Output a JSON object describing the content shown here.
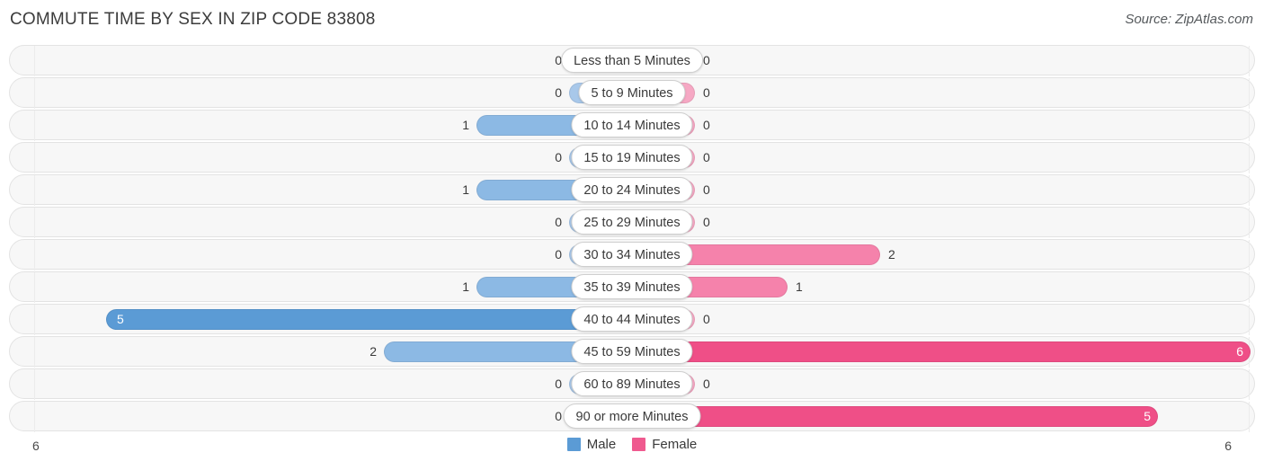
{
  "header": {
    "title": "COMMUTE TIME BY SEX IN ZIP CODE 83808",
    "source": "Source: ZipAtlas.com"
  },
  "legend": {
    "items": [
      {
        "label": "Male",
        "color": "#5b9bd5"
      },
      {
        "label": "Female",
        "color": "#ef5a8f"
      }
    ]
  },
  "axis": {
    "left_label": "6",
    "right_label": "6"
  },
  "colors": {
    "male_strong": "#5b9bd5",
    "male_mid": "#8cb9e4",
    "male_pale": "#a8c8ea",
    "female_strong": "#ef4f87",
    "female_mid": "#f582ab",
    "female_pale": "#f6a8c4",
    "track_fill": "#f7f7f7",
    "track_border": "#e3e3e3"
  },
  "chart_data": {
    "type": "bar",
    "subtype": "diverging-bidirectional",
    "title": "COMMUTE TIME BY SEX IN ZIP CODE 83808",
    "xlabel": "",
    "ylabel": "",
    "xlim": [
      6,
      6
    ],
    "grid": false,
    "legend_position": "bottom-center",
    "categories": [
      "Less than 5 Minutes",
      "5 to 9 Minutes",
      "10 to 14 Minutes",
      "15 to 19 Minutes",
      "20 to 24 Minutes",
      "25 to 29 Minutes",
      "30 to 34 Minutes",
      "35 to 39 Minutes",
      "40 to 44 Minutes",
      "45 to 59 Minutes",
      "60 to 89 Minutes",
      "90 or more Minutes"
    ],
    "series": [
      {
        "name": "Male",
        "direction": "left",
        "values": [
          0,
          0,
          1,
          0,
          1,
          0,
          0,
          1,
          5,
          2,
          0,
          0
        ]
      },
      {
        "name": "Female",
        "direction": "right",
        "values": [
          0,
          0,
          0,
          0,
          0,
          0,
          2,
          1,
          0,
          6,
          0,
          5
        ]
      }
    ]
  },
  "rows": [
    {
      "category": "Less than 5 Minutes",
      "male": "0",
      "female": "0"
    },
    {
      "category": "5 to 9 Minutes",
      "male": "0",
      "female": "0"
    },
    {
      "category": "10 to 14 Minutes",
      "male": "1",
      "female": "0"
    },
    {
      "category": "15 to 19 Minutes",
      "male": "0",
      "female": "0"
    },
    {
      "category": "20 to 24 Minutes",
      "male": "1",
      "female": "0"
    },
    {
      "category": "25 to 29 Minutes",
      "male": "0",
      "female": "0"
    },
    {
      "category": "30 to 34 Minutes",
      "male": "0",
      "female": "2"
    },
    {
      "category": "35 to 39 Minutes",
      "male": "1",
      "female": "1"
    },
    {
      "category": "40 to 44 Minutes",
      "male": "5",
      "female": "0"
    },
    {
      "category": "45 to 59 Minutes",
      "male": "2",
      "female": "6"
    },
    {
      "category": "60 to 89 Minutes",
      "male": "0",
      "female": "0"
    },
    {
      "category": "90 or more Minutes",
      "male": "0",
      "female": "5"
    }
  ]
}
